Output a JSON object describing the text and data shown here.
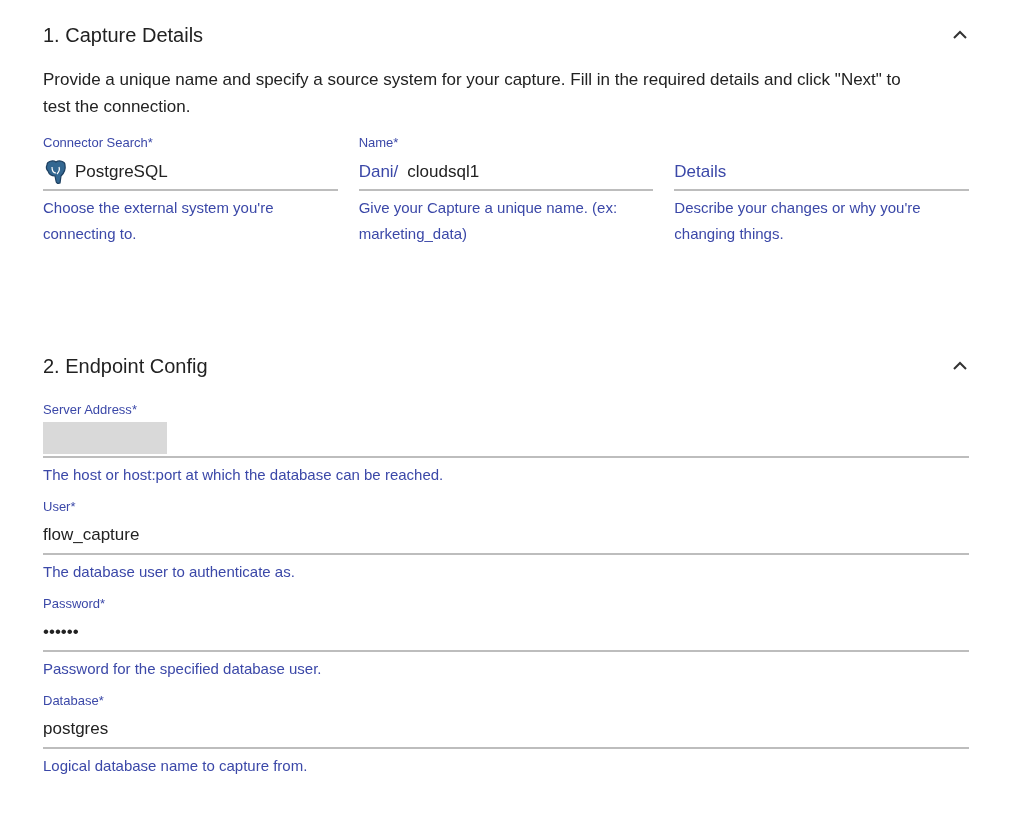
{
  "sections": [
    {
      "title": "1. Capture Details",
      "expanded": true,
      "description": "Provide a unique name and specify a source system for your capture. Fill in the required details and click \"Next\" to test the connection.",
      "columns": [
        {
          "kind": "connector",
          "label": "Connector Search",
          "required_mark": "*",
          "value": "PostgreSQL",
          "helper": "Choose the external system you're connecting to."
        },
        {
          "kind": "prefixed",
          "label": "Name",
          "required_mark": "*",
          "prefix": "Dani/",
          "value": "cloudsql1",
          "helper": "Give your Capture a unique name. (ex: marketing_data)"
        },
        {
          "kind": "placeholder",
          "placeholder": "Details",
          "helper": "Describe your changes or why you're changing things."
        }
      ]
    },
    {
      "title": "2. Endpoint Config",
      "expanded": true,
      "fields": [
        {
          "kind": "redacted",
          "label": "Server Address",
          "required_mark": "*",
          "helper": "The host or host:port at which the database can be reached."
        },
        {
          "kind": "text",
          "label": "User",
          "required_mark": "*",
          "value": "flow_capture",
          "helper": "The database user to authenticate as."
        },
        {
          "kind": "password",
          "label": "Password",
          "required_mark": "*",
          "value": "••••••",
          "helper": "Password for the specified database user."
        },
        {
          "kind": "text",
          "label": "Database",
          "required_mark": "*",
          "value": "postgres",
          "helper": "Logical database name to capture from."
        }
      ]
    }
  ]
}
